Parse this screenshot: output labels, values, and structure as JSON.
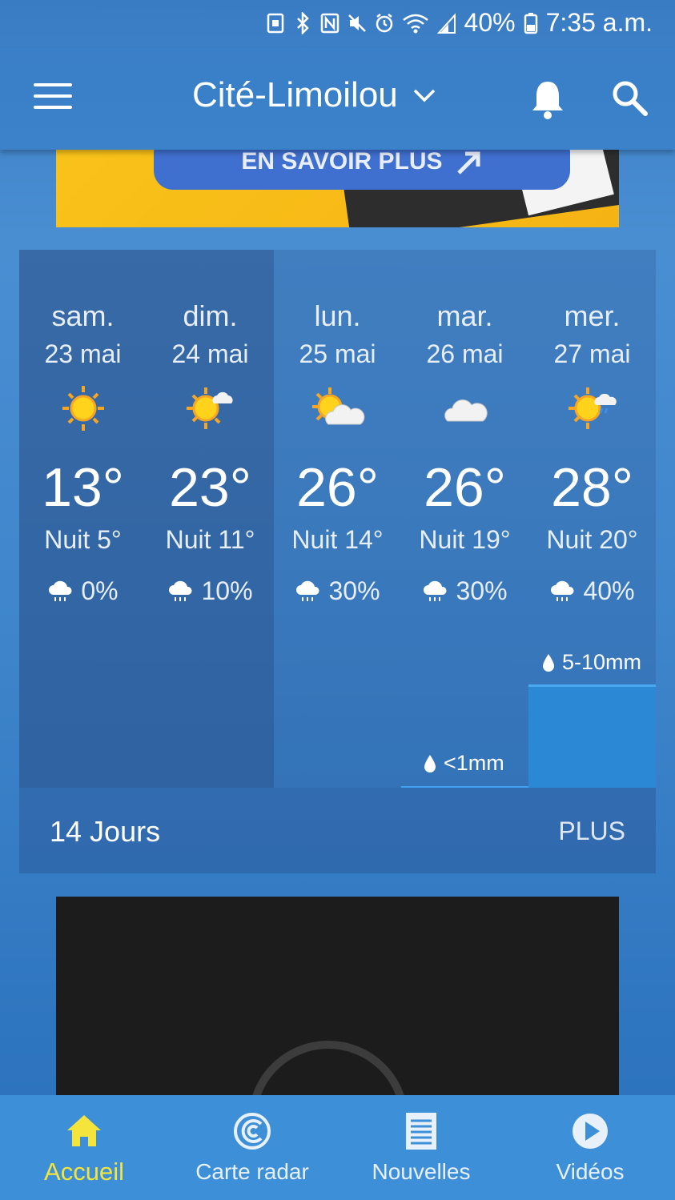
{
  "status_bar": {
    "battery": "40%",
    "time": "7:35 a.m."
  },
  "header": {
    "location": "Cité-Limoilou"
  },
  "ad": {
    "button_label": "EN SAVOIR PLUS"
  },
  "forecast": {
    "days": [
      {
        "name": "sam.",
        "date": "23 mai",
        "icon": "sun-icon",
        "high": "13°",
        "night": "Nuit 5°",
        "precip": "0%"
      },
      {
        "name": "dim.",
        "date": "24 mai",
        "icon": "sun-cloud-icon",
        "high": "23°",
        "night": "Nuit 11°",
        "precip": "10%"
      },
      {
        "name": "lun.",
        "date": "25 mai",
        "icon": "sun-cloud-icon",
        "high": "26°",
        "night": "Nuit 14°",
        "precip": "30%"
      },
      {
        "name": "mar.",
        "date": "26 mai",
        "icon": "cloud-icon",
        "high": "26°",
        "night": "Nuit 19°",
        "precip": "30%"
      },
      {
        "name": "mer.",
        "date": "27 mai",
        "icon": "sun-cloud-rain-icon",
        "high": "28°",
        "night": "Nuit 20°",
        "precip": "40%"
      }
    ],
    "rain_amounts": {
      "mar": "<1mm",
      "mer": "5-10mm"
    },
    "footer_title": "14 Jours",
    "footer_more": "PLUS"
  },
  "nav": {
    "items": [
      {
        "label": "Accueil",
        "icon": "home-icon",
        "active": true
      },
      {
        "label": "Carte radar",
        "icon": "radar-icon"
      },
      {
        "label": "Nouvelles",
        "icon": "news-icon"
      },
      {
        "label": "Vidéos",
        "icon": "play-icon"
      }
    ]
  },
  "colors": {
    "accent_active": "#f5e43c",
    "rain_bar": "#2a88d4",
    "nav_bg": "#3d8fd8"
  }
}
